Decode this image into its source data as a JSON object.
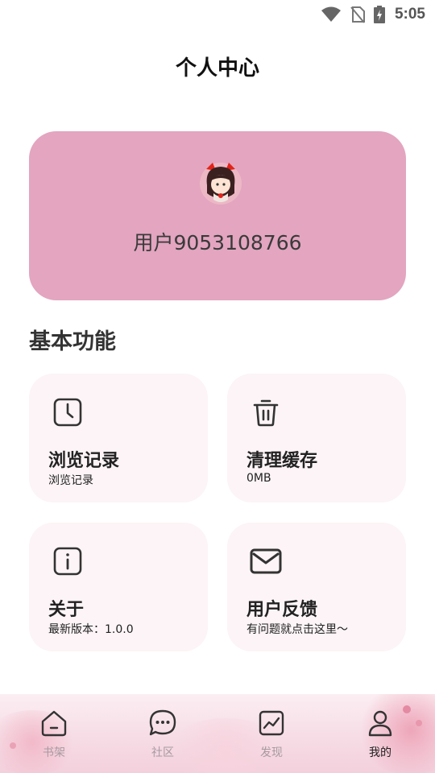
{
  "status_bar": {
    "time": "5:05",
    "icons": [
      "wifi-icon",
      "no-sim-icon",
      "battery-charging-icon"
    ]
  },
  "header": {
    "title": "个人中心"
  },
  "profile": {
    "username": "用户9053108766",
    "avatar_icon": "avatar-girl-icon",
    "card_color": "#e3a5bf"
  },
  "section": {
    "title": "基本功能"
  },
  "tiles": [
    {
      "title": "浏览记录",
      "subtitle": "浏览记录",
      "icon": "clock-icon"
    },
    {
      "title": "清理缓存",
      "subtitle": "0MB",
      "icon": "trash-icon"
    },
    {
      "title": "关于",
      "subtitle": "最新版本：1.0.0",
      "icon": "info-icon"
    },
    {
      "title": "用户反馈",
      "subtitle": "有问题就点击这里～",
      "icon": "mail-icon"
    }
  ],
  "tabs": [
    {
      "label": "书架",
      "icon": "bookshelf-icon",
      "active": false
    },
    {
      "label": "社区",
      "icon": "chat-bubble-icon",
      "active": false
    },
    {
      "label": "发现",
      "icon": "trend-chart-icon",
      "active": false
    },
    {
      "label": "我的",
      "icon": "user-icon",
      "active": true
    }
  ]
}
